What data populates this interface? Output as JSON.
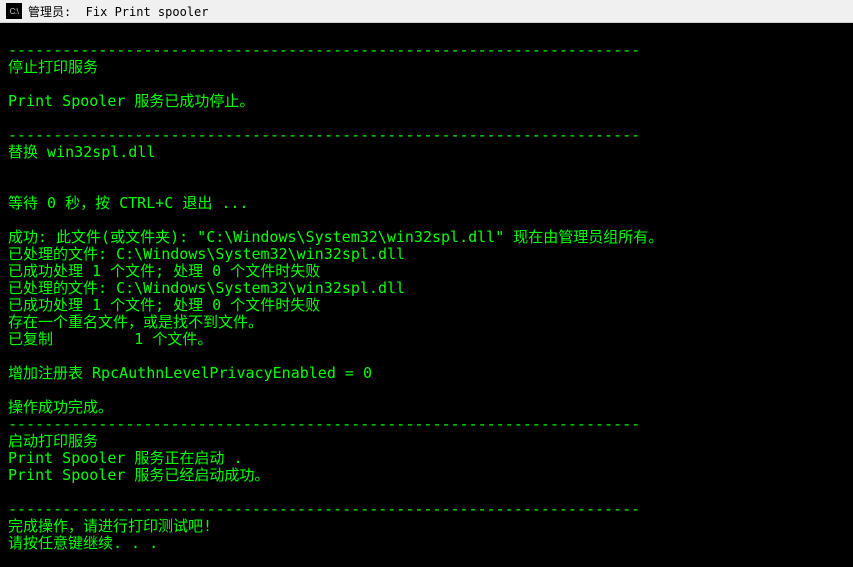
{
  "titlebar": {
    "icon_text": "C:\\",
    "title": "管理员:  Fix Print spooler"
  },
  "terminal": {
    "lines": [
      "",
      "----------------------------------------------------------------------",
      "停止打印服务",
      "",
      "Print Spooler 服务已成功停止。",
      "",
      "----------------------------------------------------------------------",
      "替换 win32spl.dll",
      "",
      "",
      "等待 0 秒，按 CTRL+C 退出 ...",
      "",
      "成功: 此文件(或文件夹): \"C:\\Windows\\System32\\win32spl.dll\" 现在由管理员组所有。",
      "已处理的文件: C:\\Windows\\System32\\win32spl.dll",
      "已成功处理 1 个文件; 处理 0 个文件时失败",
      "已处理的文件: C:\\Windows\\System32\\win32spl.dll",
      "已成功处理 1 个文件; 处理 0 个文件时失败",
      "存在一个重名文件，或是找不到文件。",
      "已复制         1 个文件。",
      "",
      "增加注册表 RpcAuthnLevelPrivacyEnabled = 0",
      "",
      "操作成功完成。",
      "----------------------------------------------------------------------",
      "启动打印服务",
      "Print Spooler 服务正在启动 .",
      "Print Spooler 服务已经启动成功。",
      "",
      "----------------------------------------------------------------------",
      "完成操作，请进行打印测试吧!",
      "请按任意键继续. . ."
    ]
  }
}
